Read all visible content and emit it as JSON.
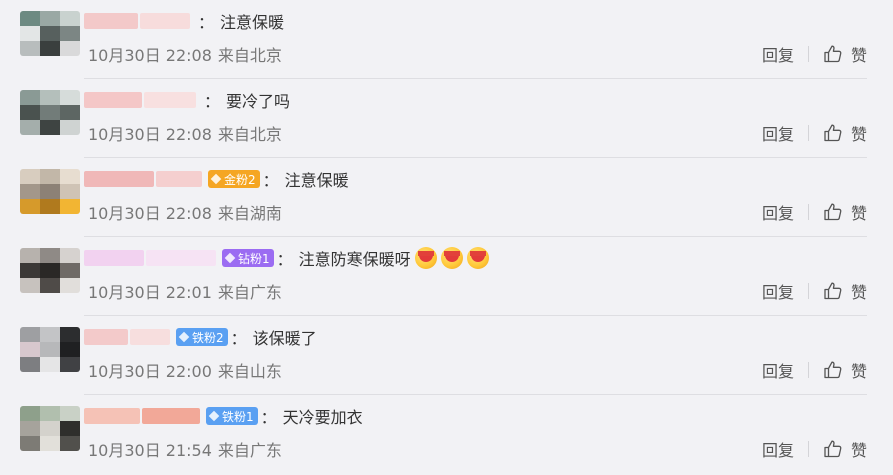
{
  "comments": [
    {
      "nick_colors": [
        "#f3c9c9",
        "#f7dcdc"
      ],
      "badge": null,
      "text": "注意保暖",
      "emoji_count": 0,
      "date": "10月30日 22:08",
      "location": "来自北京",
      "reply_label": "回复",
      "like_label": "赞",
      "avatar_colors": [
        "#6d8a82",
        "#9aa8a4",
        "#c9d2cf",
        "#e3e6e6",
        "#57605e",
        "#7c8684",
        "#b8bdbd",
        "#3a3f3e",
        "#d9d9da"
      ]
    },
    {
      "nick_colors": [
        "#f4c7c7",
        "#f8e0e0"
      ],
      "badge": null,
      "text": "要冷了吗",
      "emoji_count": 0,
      "date": "10月30日 22:08",
      "location": "来自北京",
      "reply_label": "回复",
      "like_label": "赞",
      "avatar_colors": [
        "#8a9a95",
        "#b4bfbb",
        "#d6dcda",
        "#4a524f",
        "#727c79",
        "#5d6663",
        "#a4aeab",
        "#3e4442",
        "#cfd3d2"
      ]
    },
    {
      "nick_colors": [
        "#f0b8b8",
        "#f5cfcf"
      ],
      "badge": {
        "label": "金粉2",
        "color": "#f5a623"
      },
      "text": "注意保暖",
      "emoji_count": 0,
      "date": "10月30日 22:08",
      "location": "来自湖南",
      "reply_label": "回复",
      "like_label": "赞",
      "avatar_colors": [
        "#d8cdbf",
        "#c2b7a8",
        "#e7ddd0",
        "#a3978a",
        "#8c8176",
        "#cfc3b5",
        "#d69a2b",
        "#b07a1e",
        "#f2b533"
      ]
    },
    {
      "nick_colors": [
        "#f2d2f0",
        "#f6e3f4"
      ],
      "badge": {
        "label": "钻粉1",
        "color": "#9b6cf2"
      },
      "text": "注意防寒保暖呀",
      "emoji_count": 3,
      "date": "10月30日 22:01",
      "location": "来自广东",
      "reply_label": "回复",
      "like_label": "赞",
      "avatar_colors": [
        "#b7b2ad",
        "#8f8a86",
        "#d6d2cf",
        "#3b3836",
        "#2a2826",
        "#6f6a66",
        "#c7c2be",
        "#4f4b48",
        "#e1dedb"
      ]
    },
    {
      "nick_colors": [
        "#f3caca",
        "#f7dede"
      ],
      "badge": {
        "label": "铁粉2",
        "color": "#5aa0f2"
      },
      "text": "该保暖了",
      "emoji_count": 0,
      "date": "10月30日 22:00",
      "location": "来自山东",
      "reply_label": "回复",
      "like_label": "赞",
      "avatar_colors": [
        "#9e9fa2",
        "#c3c4c6",
        "#2c2d2f",
        "#d8c8ce",
        "#b7b8ba",
        "#1f2022",
        "#7d7e81",
        "#e5e5e6",
        "#404144"
      ]
    },
    {
      "nick_colors": [
        "#f5c2b6",
        "#f2a898"
      ],
      "badge": {
        "label": "铁粉1",
        "color": "#5aa0f2"
      },
      "text": "天冷要加衣",
      "emoji_count": 0,
      "date": "10月30日 21:54",
      "location": "来自广东",
      "reply_label": "回复",
      "like_label": "赞",
      "avatar_colors": [
        "#8ea08b",
        "#b1bfae",
        "#c9d1c6",
        "#a6a39c",
        "#d4d2cc",
        "#2f2f2c",
        "#7d7b75",
        "#e2e0da",
        "#51504c"
      ]
    }
  ]
}
